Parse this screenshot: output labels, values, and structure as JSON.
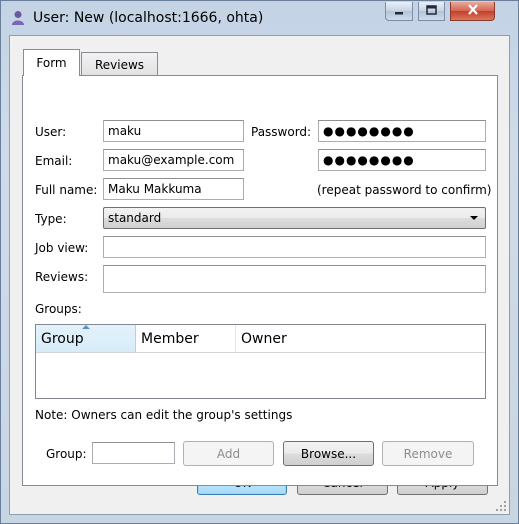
{
  "window": {
    "title": "User: New (localhost:1666, ohta)"
  },
  "tabs": [
    {
      "label": "Form",
      "active": true
    },
    {
      "label": "Reviews",
      "active": false
    }
  ],
  "form": {
    "user_label": "User:",
    "user_value": "maku",
    "password_label": "Password:",
    "password_value": "●●●●●●●●",
    "email_label": "Email:",
    "email_value": "maku@example.com",
    "password_confirm_value": "●●●●●●●●",
    "fullname_label": "Full name:",
    "fullname_value": "Maku Makkuma",
    "confirm_hint": "(repeat password to confirm)",
    "type_label": "Type:",
    "type_value": "standard",
    "jobview_label": "Job view:",
    "jobview_value": "",
    "reviews_label": "Reviews:",
    "reviews_value": "",
    "groups_label": "Groups:"
  },
  "groups_table": {
    "columns": [
      "Group",
      "Member",
      "Owner"
    ],
    "sorted_column": "Group",
    "rows": []
  },
  "note": "Note: Owners can edit the group's settings",
  "group_controls": {
    "group_label": "Group:",
    "group_value": "",
    "add_label": "Add",
    "browse_label": "Browse...",
    "remove_label": "Remove"
  },
  "dialog_buttons": {
    "ok_label": "OK",
    "cancel_label": "Cancel",
    "apply_label": "Apply"
  },
  "icons": {
    "app": "user-icon",
    "minimize": "minimize-icon",
    "maximize": "maximize-icon",
    "close": "close-icon"
  }
}
